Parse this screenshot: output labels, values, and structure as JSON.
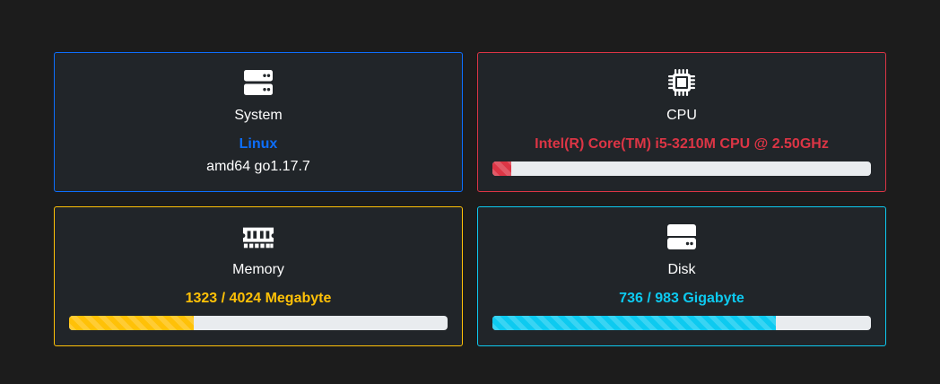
{
  "colors": {
    "page_background": "#1c1c1c",
    "card_background": "#212529",
    "system": "#0d6efd",
    "cpu": "#dc3545",
    "memory": "#ffc107",
    "disk": "#0dcaf0",
    "progress_track": "#e9ecef"
  },
  "system": {
    "icon": "server-icon",
    "title": "System",
    "os": "Linux",
    "details": "amd64 go1.17.7"
  },
  "cpu": {
    "icon": "cpu-chip-icon",
    "title": "CPU",
    "model": "Intel(R) Core(TM) i5-3210M CPU @ 2.50GHz",
    "usage_fraction": 0.05
  },
  "memory": {
    "icon": "memory-icon",
    "title": "Memory",
    "usage_text": "1323 / 4024 Megabyte",
    "used": 1323,
    "total": 4024
  },
  "disk": {
    "icon": "hdd-icon",
    "title": "Disk",
    "usage_text": "736 / 983 Gigabyte",
    "used": 736,
    "total": 983
  }
}
